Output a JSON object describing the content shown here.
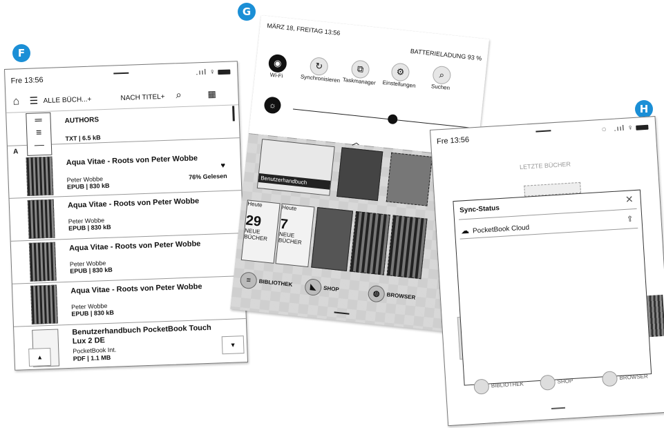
{
  "badges": {
    "f": "F",
    "g": "G",
    "h": "H"
  },
  "f": {
    "time": "Fre 13:56",
    "signal": ".ııl ♀",
    "filter": "ALLE BÜCH...+",
    "sort": "NACH TITEL+",
    "section_letter": "A",
    "rows": [
      {
        "title": "AUTHORS",
        "meta": "TXT | 6.5 kB"
      },
      {
        "title": "Aqua Vitae - Roots von Peter Wobbe",
        "author": "Peter Wobbe",
        "meta": "EPUB | 830 kB",
        "read": "76% Gelesen"
      },
      {
        "title": "Aqua Vitae - Roots von Peter Wobbe",
        "author": "Peter Wobbe",
        "meta": "EPUB | 830 kB"
      },
      {
        "title": "Aqua Vitae - Roots von Peter Wobbe",
        "author": "Peter Wobbe",
        "meta": "EPUB | 830 kB"
      },
      {
        "title": "Aqua Vitae - Roots von Peter Wobbe",
        "author": "Peter Wobbe",
        "meta": "EPUB | 830 kB"
      },
      {
        "title": "Benutzerhandbuch PocketBook Touch",
        "title2": "Lux 2 DE",
        "author": "PocketBook Int.",
        "meta": "PDF | 1.1 MB"
      }
    ]
  },
  "g": {
    "date": "MÄRZ 18, FREITAG 13:56",
    "battery": "BATTERIELADUNG 93 %",
    "quick": [
      "Wi-Fi",
      "Synchronisieren",
      "Taskmanager",
      "Einstellungen",
      "Suchen"
    ],
    "manual": "Benutzerhandbuch",
    "tiles": [
      {
        "head": "Heute",
        "num": "29",
        "l1": "NEUE",
        "l2": "BÜCHER"
      },
      {
        "head": "Heute",
        "num": "7",
        "l1": "NEUE",
        "l2": "BÜCHER"
      }
    ],
    "nav": [
      "BIBLIOTHEK",
      "SHOP",
      "BROWSER"
    ]
  },
  "h": {
    "time": "Fre 13:56",
    "signal": ".ııl ♀",
    "recent": "LETZTE BÜCHER",
    "dialog_title": "Sync-Status",
    "cloud": "PocketBook Cloud",
    "nav": [
      "BIBLIOTHEK",
      "SHOP",
      "BROWSER"
    ]
  },
  "colors": {
    "badge": "#1b8fd6"
  }
}
